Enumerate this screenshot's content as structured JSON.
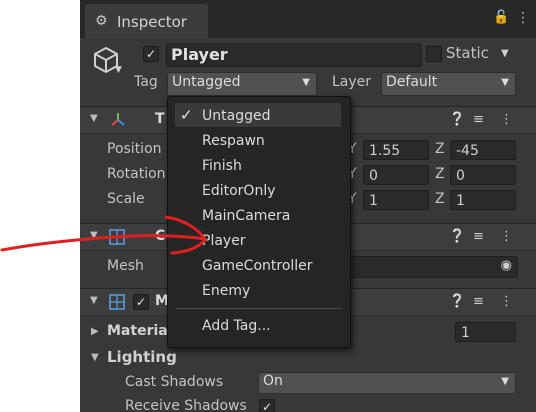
{
  "inspector": {
    "tab_title": "Inspector",
    "object": {
      "name": "Player",
      "active": true,
      "static_label": "Static",
      "tag_label": "Tag",
      "tag_value": "Untagged",
      "layer_label": "Layer",
      "layer_value": "Default"
    },
    "transform": {
      "title": "T",
      "rows": [
        {
          "label": "Position",
          "y": "1.55",
          "z": "-45"
        },
        {
          "label": "Rotation",
          "y": "0",
          "z": "0"
        },
        {
          "label": "Scale",
          "y": "1",
          "z": "1"
        }
      ],
      "y_label": "Y",
      "z_label": "Z"
    },
    "mesh_filter": {
      "title": "C",
      "mesh_label": "Mesh"
    },
    "mesh_renderer": {
      "title": "M",
      "materials_label": "Materia",
      "materials_count": "1",
      "lighting_label": "Lighting",
      "cast_shadows_label": "Cast Shadows",
      "cast_shadows_value": "On",
      "receive_shadows_label": "Receive Shadows"
    }
  },
  "tag_menu": {
    "items": [
      "Untagged",
      "Respawn",
      "Finish",
      "EditorOnly",
      "MainCamera",
      "Player",
      "GameController",
      "Enemy"
    ],
    "selected": "Untagged",
    "add_label": "Add Tag..."
  },
  "colors": {
    "panel_bg": "#383838",
    "annotation_red": "#e02020"
  }
}
